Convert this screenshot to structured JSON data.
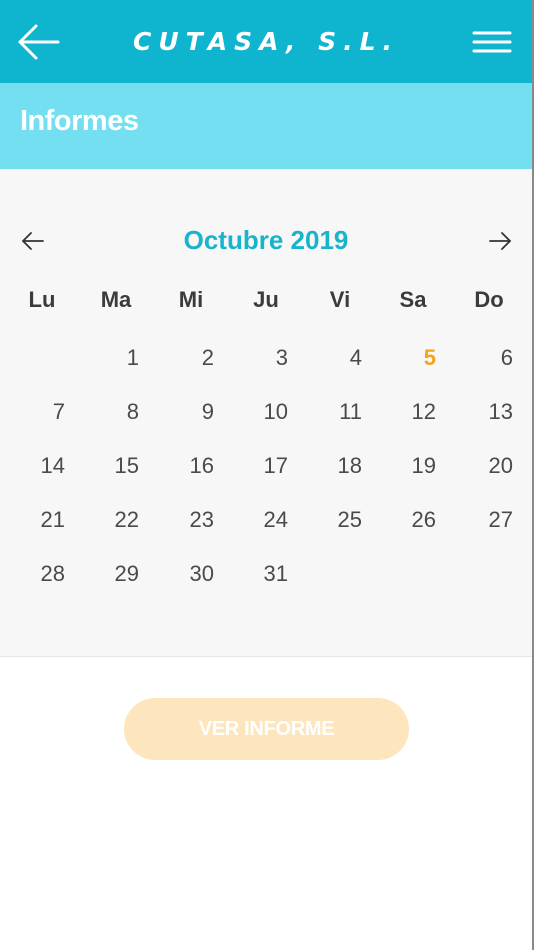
{
  "header": {
    "brand": "CUTASA, S.L.",
    "back_icon": "arrow-left-icon",
    "menu_icon": "hamburger-menu-icon",
    "background_color": "#0fb4cf"
  },
  "section": {
    "title": "Informes",
    "background_color": "#73dff0"
  },
  "calendar": {
    "month_title": "Octubre 2019",
    "prev_icon": "arrow-left-icon",
    "next_icon": "arrow-right-icon",
    "weekdays": [
      "Lu",
      "Ma",
      "Mi",
      "Ju",
      "Vi",
      "Sa",
      "Do"
    ],
    "weeks": [
      [
        "",
        "1",
        "2",
        "3",
        "4",
        "5",
        "6"
      ],
      [
        "7",
        "8",
        "9",
        "10",
        "11",
        "12",
        "13"
      ],
      [
        "14",
        "15",
        "16",
        "17",
        "18",
        "19",
        "20"
      ],
      [
        "21",
        "22",
        "23",
        "24",
        "25",
        "26",
        "27"
      ],
      [
        "28",
        "29",
        "30",
        "31",
        "",
        "",
        ""
      ]
    ],
    "highlighted_day": "5",
    "highlight_color": "#f4a519"
  },
  "action": {
    "label": "VER INFORME",
    "background_color": "#fde6bd"
  }
}
